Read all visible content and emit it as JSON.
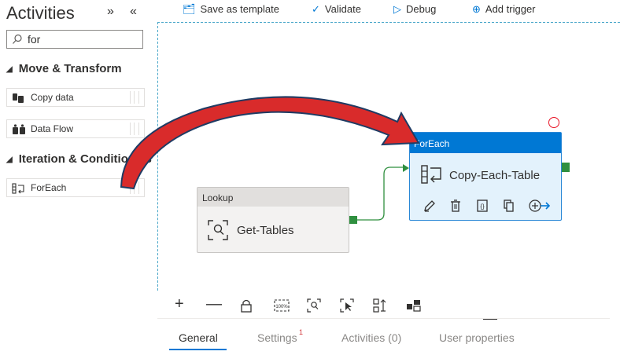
{
  "panel": {
    "title": "Activities",
    "search": {
      "value": "for"
    },
    "categories": [
      {
        "label": "Move & Transform"
      },
      {
        "label": "Iteration & Conditionals"
      }
    ],
    "items": [
      {
        "label": "Copy data"
      },
      {
        "label": "Data Flow"
      },
      {
        "label": "ForEach"
      }
    ]
  },
  "toolbar": {
    "save_template": "Save as template",
    "validate": "Validate",
    "debug": "Debug",
    "add_trigger": "Add trigger"
  },
  "canvas": {
    "lookup": {
      "type": "Lookup",
      "name": "Get-Tables"
    },
    "foreach": {
      "type": "ForEach",
      "name": "Copy-Each-Table"
    }
  },
  "bottom_tabs": {
    "general": "General",
    "settings": "Settings",
    "settings_badge": "1",
    "activities": "Activities (0)",
    "user_properties": "User properties"
  },
  "colors": {
    "accent": "#0078d4",
    "success_green": "#2f8f3f",
    "annotation_arrow": "#d92b2b",
    "error": "#e81123"
  }
}
